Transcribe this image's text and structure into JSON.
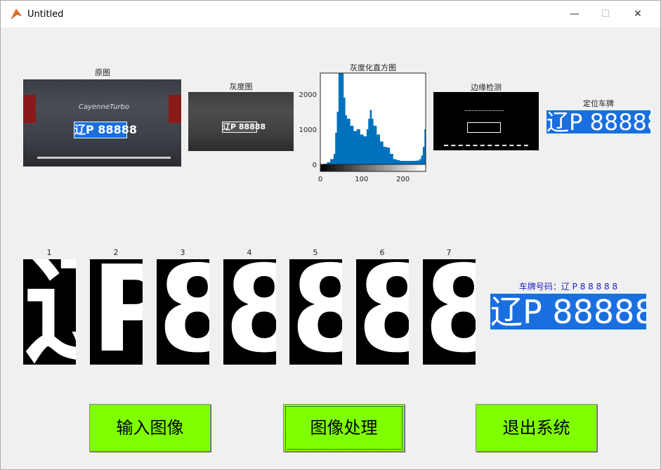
{
  "window": {
    "title": "Untitled",
    "minimize": "—",
    "maximize": "☐",
    "close": "✕"
  },
  "axes": {
    "original": {
      "title": "原图",
      "plate_text": "辽P 88888",
      "badge": "CayenneTurbo"
    },
    "gray": {
      "title": "灰度图",
      "plate_text": "辽P 88888"
    },
    "histogram": {
      "title": "灰度化直方图"
    },
    "edge": {
      "title": "边缘检测"
    },
    "located": {
      "title": "定位车牌",
      "plate_text": "辽P 88888"
    }
  },
  "chart_data": {
    "type": "bar",
    "title": "灰度化直方图",
    "xlim": [
      0,
      255
    ],
    "ylim": [
      0,
      2600
    ],
    "xticks": [
      0,
      100,
      200
    ],
    "yticks": [
      0,
      1000,
      2000
    ],
    "x": [
      0,
      8,
      16,
      24,
      32,
      36,
      40,
      44,
      48,
      52,
      56,
      60,
      64,
      72,
      80,
      88,
      96,
      104,
      112,
      116,
      120,
      124,
      128,
      136,
      144,
      152,
      160,
      168,
      176,
      184,
      192,
      200,
      208,
      216,
      224,
      232,
      240,
      244,
      248,
      252,
      255
    ],
    "values": [
      0,
      20,
      60,
      150,
      300,
      900,
      1500,
      2600,
      2600,
      2600,
      1900,
      1400,
      1300,
      1100,
      950,
      1000,
      850,
      800,
      1000,
      1300,
      1550,
      1300,
      1100,
      850,
      650,
      500,
      480,
      300,
      150,
      120,
      100,
      100,
      100,
      100,
      100,
      110,
      150,
      250,
      500,
      1000,
      1400
    ],
    "color": "#0072bd",
    "colorbar": "grayscale"
  },
  "characters": [
    {
      "label": "1",
      "glyph": "辽"
    },
    {
      "label": "2",
      "glyph": "P"
    },
    {
      "label": "3",
      "glyph": "8"
    },
    {
      "label": "4",
      "glyph": "8"
    },
    {
      "label": "5",
      "glyph": "8"
    },
    {
      "label": "6",
      "glyph": "8"
    },
    {
      "label": "7",
      "glyph": "8"
    }
  ],
  "result": {
    "label": "车牌号码：辽 P 8 8 8 8 8",
    "plate_text": "辽P 88888",
    "label_color": "#2020c0"
  },
  "buttons": {
    "input": "输入图像",
    "process": "图像处理",
    "exit": "退出系统",
    "color": "#80ff00"
  }
}
